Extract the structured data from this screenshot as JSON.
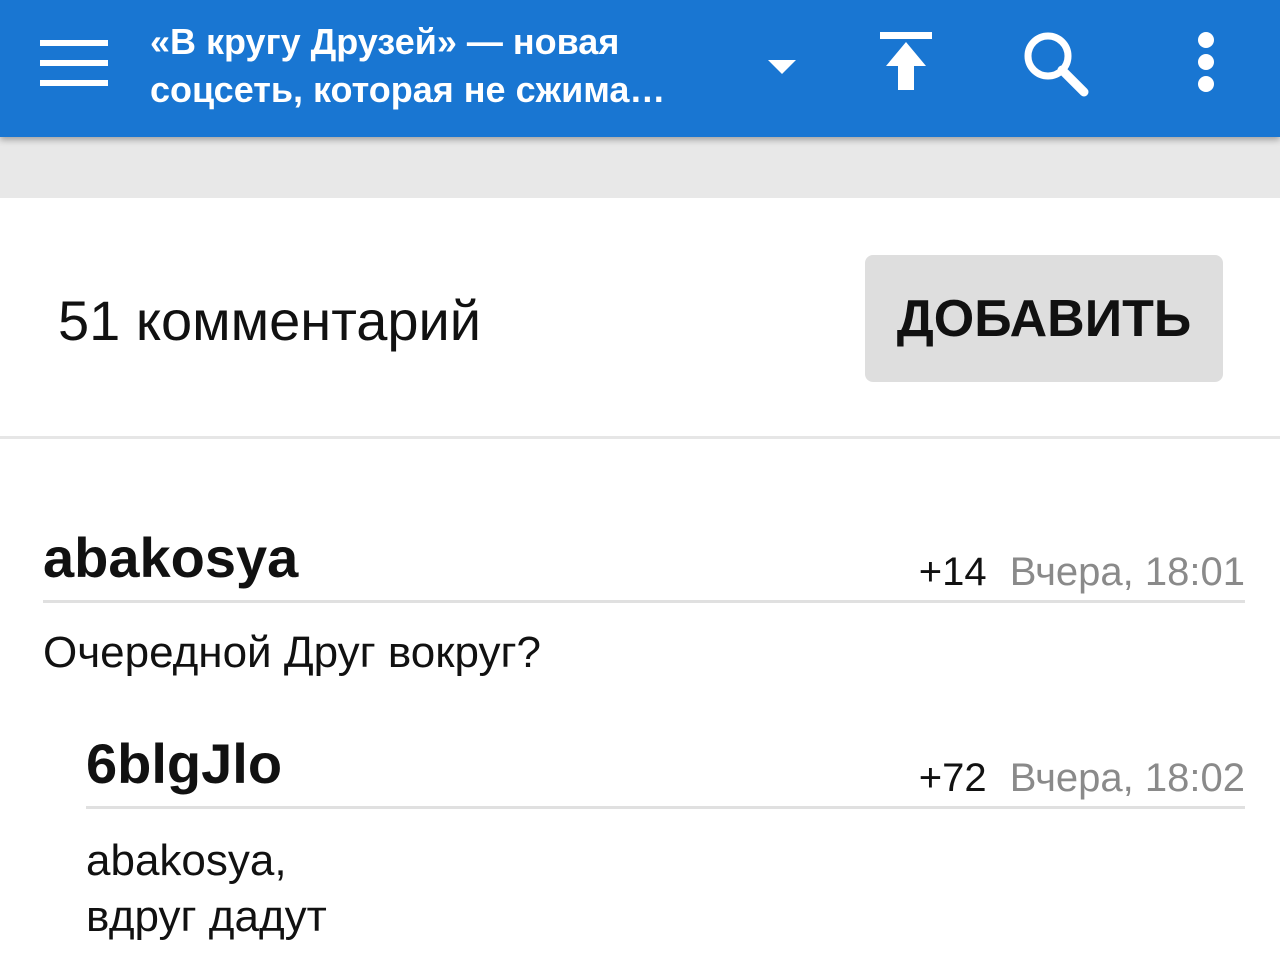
{
  "appbar": {
    "title_line1": "«В кругу Друзей» — новая",
    "title_line2": "соцсеть, которая не сжима…",
    "icons": [
      "menu-icon",
      "dropdown-arrow-icon",
      "scroll-top-icon",
      "search-icon",
      "more-vert-icon"
    ],
    "color": "#1976d2"
  },
  "comments_header": {
    "count_label": "51 комментарий",
    "add_button": "ДОБАВИТЬ"
  },
  "comments": [
    {
      "author": "abakosya",
      "score": "+14",
      "time": "Вчера, 18:01",
      "text": "Очередной Друг вокруг?"
    },
    {
      "author": "6blgJlo",
      "score": "+72",
      "time": "Вчера, 18:02",
      "text_line1": "abakosya,",
      "text_line2": "вдруг дадут"
    }
  ]
}
